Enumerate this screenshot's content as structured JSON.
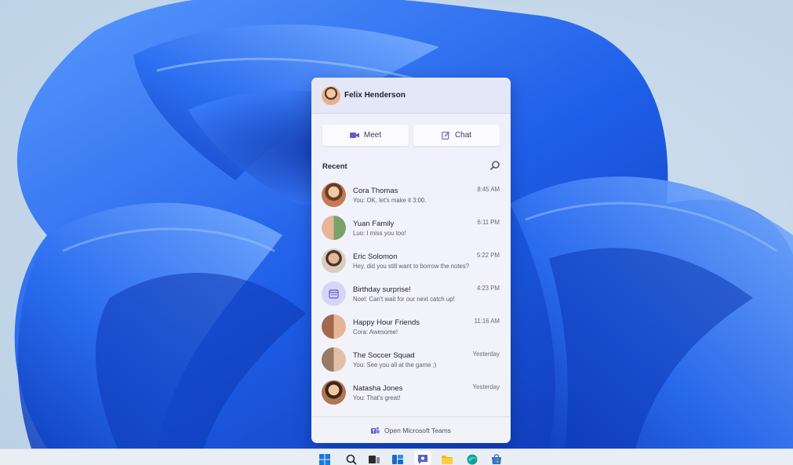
{
  "user": {
    "name": "Felix Henderson"
  },
  "actions": {
    "meet_label": "Meet",
    "chat_label": "Chat"
  },
  "recent": {
    "label": "Recent",
    "chats": [
      {
        "name": "Cora Thomas",
        "message": "You: OK, let's make it 3:00.",
        "time": "8:45 AM",
        "avatar": "single",
        "color": "#c47a55"
      },
      {
        "name": "Yuan Family",
        "message": "Luo: I miss you too!",
        "time": "6:11 PM",
        "avatar": "group",
        "color": "#7aa36a"
      },
      {
        "name": "Eric Solomon",
        "message": "Hey, did you still want to borrow the notes?",
        "time": "5:22 PM",
        "avatar": "single",
        "color": "#8d6b56"
      },
      {
        "name": "Birthday surprise!",
        "message": "Noel: Can't wait for our next catch up!",
        "time": "4:23 PM",
        "avatar": "calendar-icon",
        "color": "#c9c8f2"
      },
      {
        "name": "Happy Hour Friends",
        "message": "Cora: Awesome!",
        "time": "11:16 AM",
        "avatar": "group",
        "color": "#a4684f"
      },
      {
        "name": "The Soccer Squad",
        "message": "You: See you all at the game ;)",
        "time": "Yesterday",
        "avatar": "group",
        "color": "#9a7a62"
      },
      {
        "name": "Natasha Jones",
        "message": "You: That's great!",
        "time": "Yesterday",
        "avatar": "single",
        "color": "#b07656"
      }
    ]
  },
  "footer": {
    "label": "Open Microsoft Teams"
  },
  "taskbar": {
    "icons": [
      "windows-start-icon",
      "search-icon",
      "task-view-icon",
      "widgets-icon",
      "teams-chat-icon",
      "file-explorer-icon",
      "edge-icon",
      "store-icon"
    ]
  },
  "colors": {
    "accent": "#5b5fc7",
    "wallpaper_blue": "#1f5ee8"
  }
}
